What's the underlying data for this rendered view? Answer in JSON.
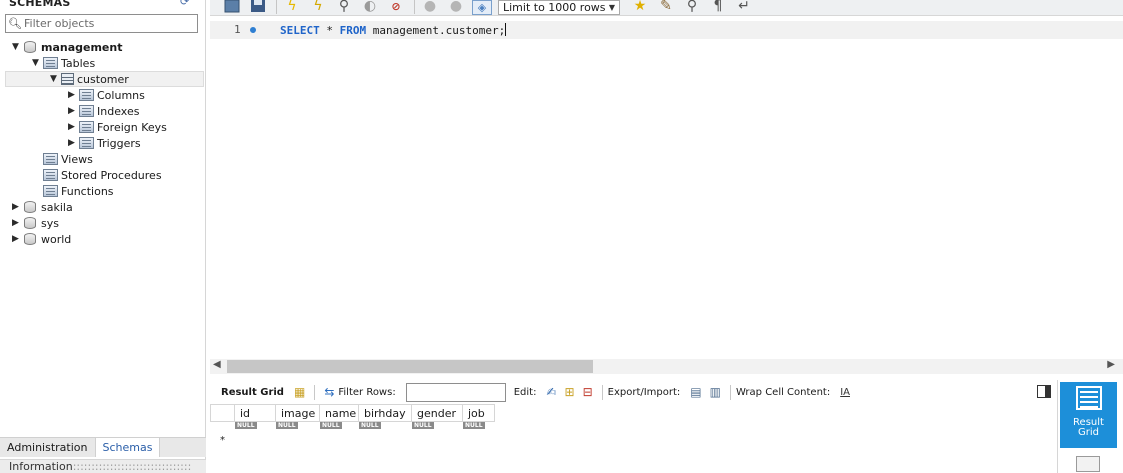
{
  "sidebar": {
    "title": "SCHEMAS",
    "filter_placeholder": "Filter objects",
    "tree": {
      "management": "management",
      "tables": "Tables",
      "customer": "customer",
      "columns": "Columns",
      "indexes": "Indexes",
      "foreign_keys": "Foreign Keys",
      "triggers": "Triggers",
      "views": "Views",
      "stored_procedures": "Stored Procedures",
      "functions": "Functions",
      "sakila": "sakila",
      "sys": "sys",
      "world": "world"
    },
    "bottom_tabs": [
      "Administration",
      "Schemas"
    ],
    "info_label": "Information"
  },
  "toolbar": {
    "limit_label": "Limit to 1000 rows"
  },
  "editor": {
    "line_number": "1",
    "keyword_select": "SELECT",
    "star": " * ",
    "keyword_from": "FROM",
    "table_ref": " management.customer;"
  },
  "result_toolbar": {
    "result_grid": "Result Grid",
    "filter_rows": "Filter Rows:",
    "edit": "Edit:",
    "export_import": "Export/Import:",
    "wrap_cell": "Wrap Cell Content:"
  },
  "grid": {
    "columns": [
      "id",
      "image",
      "name",
      "birhday",
      "gender",
      "job"
    ],
    "null_text": "NULL",
    "row_marker": "*"
  },
  "side_panel": {
    "result_grid_line1": "Result",
    "result_grid_line2": "Grid"
  },
  "colors": {
    "accent": "#1d8fd9",
    "keyword": "#1f64c9",
    "tab_active": "#2a5ea8"
  }
}
